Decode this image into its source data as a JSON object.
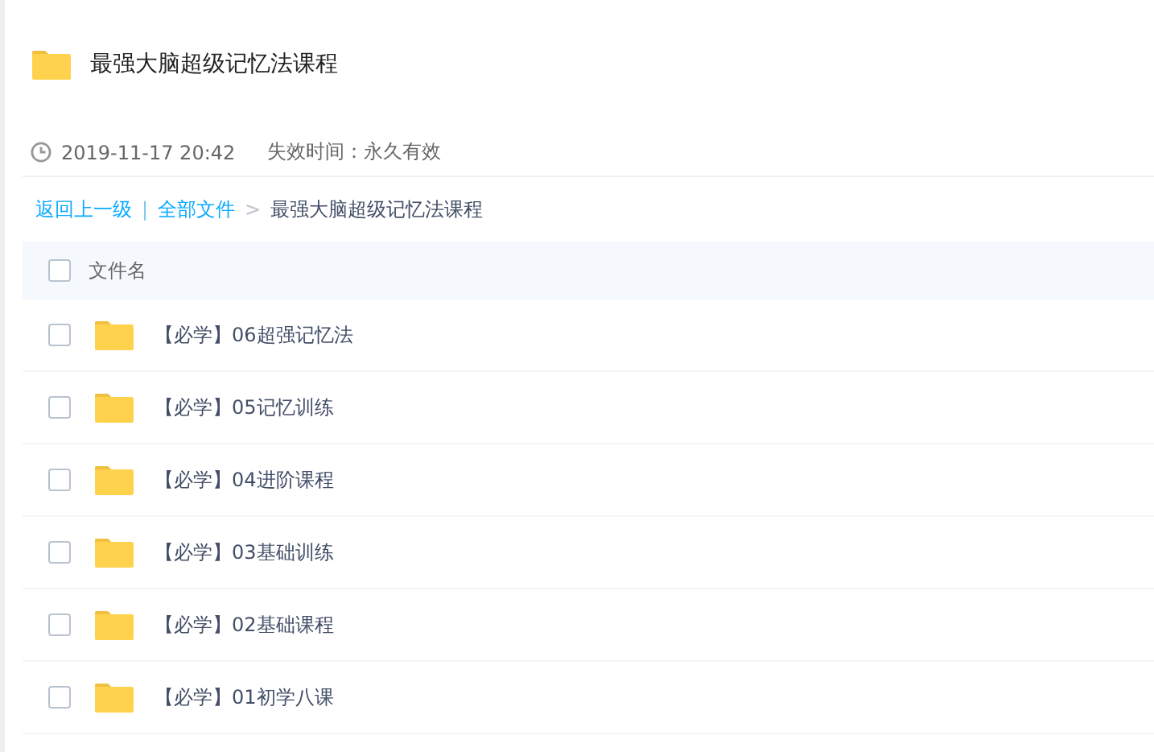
{
  "title": "最强大脑超级记忆法课程",
  "meta": {
    "date": "2019-11-17 20:42",
    "expiry": "失效时间：永久有效"
  },
  "breadcrumb": {
    "back": "返回上一级",
    "divider": "|",
    "all": "全部文件",
    "arrow": ">",
    "current": "最强大脑超级记忆法课程"
  },
  "table": {
    "header": {
      "label": "文件名",
      "checked": false
    },
    "rows": [
      {
        "name": "【必学】06超强记忆法",
        "checked": false
      },
      {
        "name": "【必学】05记忆训练",
        "checked": false
      },
      {
        "name": "【必学】04进阶课程",
        "checked": false
      },
      {
        "name": "【必学】03基础训练",
        "checked": false
      },
      {
        "name": "【必学】02基础课程",
        "checked": false
      },
      {
        "name": "【必学】01初学八课",
        "checked": false
      }
    ]
  }
}
